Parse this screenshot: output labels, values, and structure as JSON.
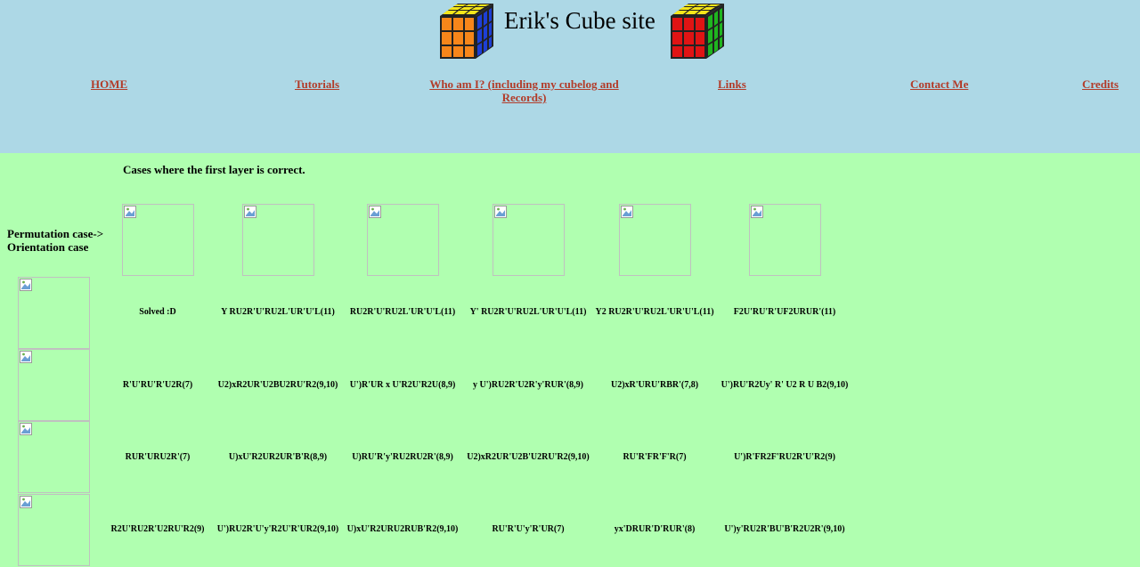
{
  "header": {
    "title": "Erik's Cube site",
    "cube_left_icon": "rubiks-cube-orange-blue-icon",
    "cube_right_icon": "rubiks-cube-red-green-icon",
    "nav": [
      {
        "label": "HOME"
      },
      {
        "label": "Tutorials"
      },
      {
        "label": "Who am I? (including my cubelog and Records)"
      },
      {
        "label": "Links"
      },
      {
        "label": "Contact Me"
      },
      {
        "label": "Credits"
      }
    ]
  },
  "main": {
    "section_title": "Cases where the first layer is correct.",
    "row_label_line1": "Permutation case->",
    "row_label_line2": "Orientation case",
    "broken_image_icon": "broken-image-icon",
    "algorithms": [
      [
        "Solved :D",
        "Y RU2R'U'RU2L'UR'U'L(11)",
        "RU2R'U'RU2L'UR'U'L(11)",
        "Y' RU2R'U'RU2L'UR'U'L(11)",
        "Y2 RU2R'U'RU2L'UR'U'L(11)",
        "F2U'RU'R'UF2URUR'(11)"
      ],
      [
        "R'U'RU'R'U2R(7)",
        "U2)xR2UR'U2BU2RU'R2(9,10)",
        "U')R'UR x U'R2U'R2U(8,9)",
        "y U')RU2R'U2R'y'RUR'(8,9)",
        "U2)xR'URU'RBR'(7,8)",
        "U')RU'R2Uy' R' U2 R U B2(9,10)"
      ],
      [
        "RUR'URU2R'(7)",
        "U)xU'R2UR2UR'B'R(8,9)",
        "U)RU'R'y'RU2RU2R'(8,9)",
        "U2)xR2UR'U2B'U2RU'R2(9,10)",
        "RU'R'FR'F'R(7)",
        "U')R'FR2F'RU2R'U'R2(9)"
      ],
      [
        "R2U'RU2R'U2RU'R2(9)",
        "U')RU2R'U'y'R2U'R'UR2(9,10)",
        "U)xU'R2URU2RUB'R2(9,10)",
        "RU'R'U'y'R'UR(7)",
        "yx'DRUR'D'RUR'(8)",
        "U')y'RU2R'BU'B'R2U2R'(9,10)"
      ]
    ]
  }
}
